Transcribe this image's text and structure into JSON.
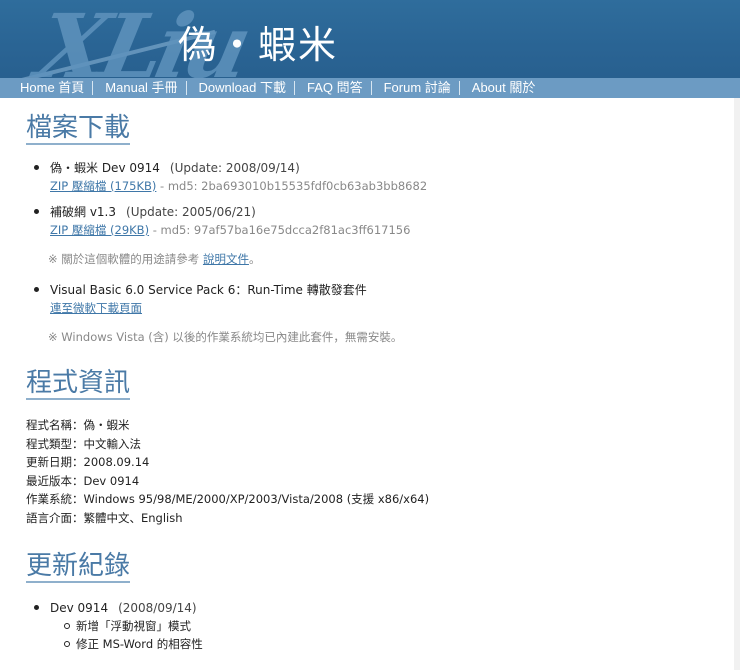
{
  "header": {
    "logo_text": "XLiu",
    "brand": "偽・蝦米"
  },
  "nav": [
    "Home 首頁",
    "Manual 手冊",
    "Download 下載",
    "FAQ 問答",
    "Forum 討論",
    "About 關於"
  ],
  "download": {
    "title": "檔案下載",
    "items": [
      {
        "name": "偽・蝦米 Dev 0914",
        "update": "(Update: 2008/09/14)",
        "link": "ZIP 壓縮檔 (175KB)",
        "md5": " - md5: 2ba693010b15535fdf0cb63ab3bb8682"
      },
      {
        "name": "補破網 v1.3",
        "update": "(Update: 2005/06/21)",
        "link": "ZIP 壓縮檔 (29KB)",
        "md5": " - md5: 97af57ba16e75dcca2f81ac3ff617156"
      }
    ],
    "note1_prefix": "※ 關於這個軟體的用途請參考 ",
    "note1_link": "說明文件",
    "note1_suffix": "。",
    "vb": {
      "name": "Visual Basic 6.0 Service Pack 6：Run-Time 轉散發套件",
      "link": "連至微軟下載頁面"
    },
    "note2": "※ Windows Vista (含) 以後的作業系統均已內建此套件，無需安裝。"
  },
  "info": {
    "title": "程式資訊",
    "lines": [
      "程式名稱：偽・蝦米",
      "程式類型：中文輸入法",
      "更新日期：2008.09.14",
      "最近版本：Dev 0914",
      "作業系統：Windows 95/98/ME/2000/XP/2003/Vista/2008 (支援 x86/x64)",
      "語言介面：繁體中文、English"
    ]
  },
  "changelog": {
    "title": "更新紀錄",
    "version": "Dev 0914",
    "date": "(2008/09/14)",
    "changes": [
      "新增「浮動視窗」模式",
      "修正 MS-Word 的相容性"
    ]
  },
  "colors": {
    "banner": "#2a6494",
    "nav": "#6c9bc3",
    "heading": "#4a7aa6",
    "link": "#3f77a8"
  }
}
